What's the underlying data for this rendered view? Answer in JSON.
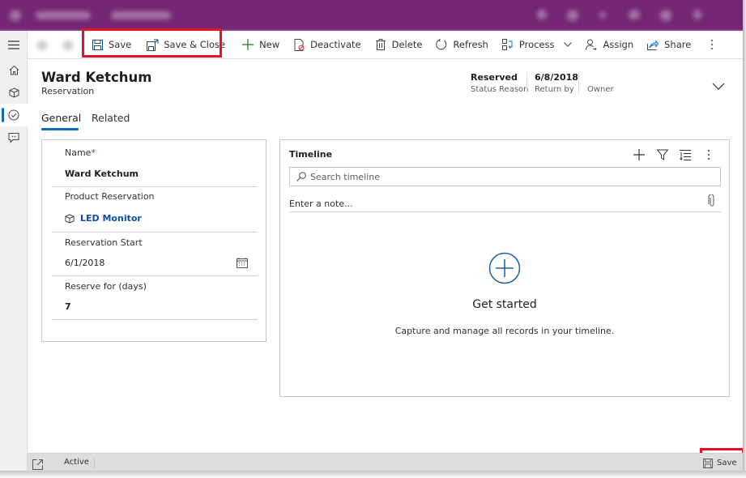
{
  "header_bar": {
    "app_name_blurred": true,
    "accent_color": "#742774"
  },
  "left_nav": {
    "items": [
      {
        "icon": "hamburger-menu-icon",
        "label": "Menu"
      },
      {
        "icon": "home-icon",
        "label": "Home"
      },
      {
        "icon": "cube-icon",
        "label": "Products"
      },
      {
        "icon": "check-circle-icon",
        "label": "Reservations",
        "active": true
      },
      {
        "icon": "chat-icon",
        "label": "Feedback"
      }
    ]
  },
  "command_bar": {
    "save": "Save",
    "save_close": "Save & Close",
    "new": "New",
    "deactivate": "Deactivate",
    "delete": "Delete",
    "refresh": "Refresh",
    "process": "Process",
    "assign": "Assign",
    "share": "Share"
  },
  "record": {
    "title": "Ward Ketchum",
    "entity": "Reservation",
    "header_fields": [
      {
        "value": "Reserved",
        "label": "Status Reason"
      },
      {
        "value": "6/8/2018",
        "label": "Return by"
      },
      {
        "value": "",
        "label": "Owner"
      }
    ]
  },
  "tabs": [
    {
      "label": "General",
      "selected": true
    },
    {
      "label": "Related",
      "selected": false
    }
  ],
  "form": {
    "fields": [
      {
        "label": "Name",
        "required_mark": "*",
        "value": "Ward Ketchum"
      },
      {
        "label": "Product Reservation",
        "value": "LED Monitor"
      },
      {
        "label": "Reservation Start",
        "value": "6/1/2018"
      },
      {
        "label": "Reserve for (days)",
        "value": "7"
      }
    ]
  },
  "timeline": {
    "title": "Timeline",
    "search_placeholder": "Search timeline",
    "note_placeholder": "Enter a note...",
    "empty_title": "Get started",
    "empty_description": "Capture and manage all records in your timeline."
  },
  "status_bar": {
    "status": "Active",
    "save": "Save"
  },
  "colors": {
    "brand": "#742774",
    "link": "#0f4ca8",
    "accent": "#0f6cbd",
    "highlight": "#e81123"
  }
}
